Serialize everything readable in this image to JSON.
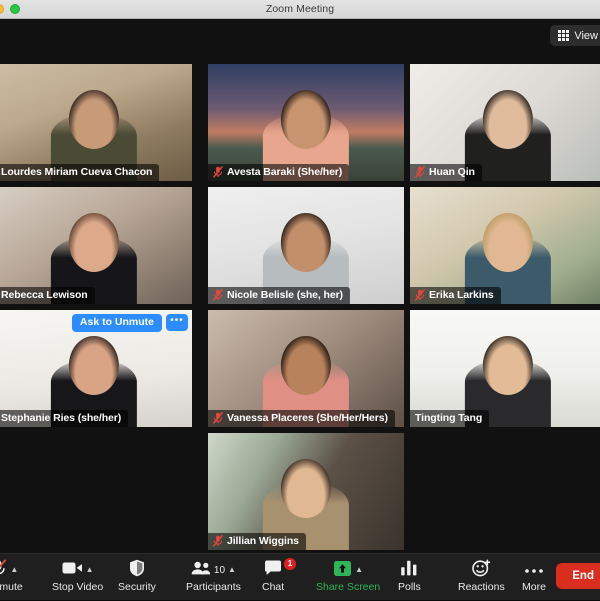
{
  "window": {
    "title": "Zoom Meeting",
    "traffic_lights": [
      "minimize-yellow",
      "maximize-green"
    ]
  },
  "stage": {
    "view_button": {
      "label": "View",
      "icon": "grid-icon"
    }
  },
  "gallery": {
    "participants": [
      {
        "name": "Lourdes Miriam Cueva Chacon",
        "muted": false,
        "speaking": false,
        "row": 1,
        "col": 1,
        "backdrop": "bg-books",
        "skin": "#c79a78",
        "hair": "#241a14",
        "shirt": "#4a4a35"
      },
      {
        "name": "Avesta Baraki (She/her)",
        "muted": true,
        "speaking": false,
        "row": 1,
        "col": 2,
        "backdrop": "bg-campus",
        "skin": "#c89470",
        "hair": "#18100c",
        "shirt": "#e8a68f"
      },
      {
        "name": "Huan Qin",
        "muted": true,
        "speaking": false,
        "row": 1,
        "col": 3,
        "backdrop": "bg-white",
        "skin": "#e0bb9c",
        "hair": "#15110f",
        "shirt": "#20201f"
      },
      {
        "name": "Rebecca Lewison",
        "muted": false,
        "speaking": false,
        "row": 2,
        "col": 1,
        "backdrop": "bg-office",
        "skin": "#dcaa8a",
        "hair": "#55382a",
        "shirt": "#16161a"
      },
      {
        "name": "Nicole Belisle (she, her)",
        "muted": true,
        "speaking": false,
        "row": 2,
        "col": 2,
        "backdrop": "bg-plain",
        "skin": "#c28f6b",
        "hair": "#1b1210",
        "shirt": "#b7bcbe"
      },
      {
        "name": "Erika Larkins",
        "muted": true,
        "speaking": false,
        "row": 2,
        "col": 3,
        "backdrop": "bg-plant",
        "skin": "#e2b894",
        "hair": "#b8995f",
        "shirt": "#3d5a6b"
      },
      {
        "name": "Stephanie Ries (she/her)",
        "muted": false,
        "speaking": false,
        "row": 3,
        "col": 1,
        "backdrop": "bg-pale",
        "skin": "#d9a385",
        "hair": "#1d1512",
        "shirt": "#17171a",
        "controls": {
          "ask_to_unmute": "Ask to Unmute",
          "more": "•••"
        }
      },
      {
        "name": "Vanessa Placeres (She/Her/Hers)",
        "muted": true,
        "speaking": false,
        "row": 3,
        "col": 2,
        "backdrop": "bg-interior",
        "skin": "#b8825c",
        "hair": "#140e0a",
        "shirt": "#e08f85"
      },
      {
        "name": "Tingting Tang",
        "muted": false,
        "speaking": true,
        "row": 3,
        "col": 3,
        "backdrop": "bg-bright",
        "skin": "#e3bb97",
        "hair": "#17120f",
        "shirt": "#2a2a2c"
      },
      {
        "name": "Jillian Wiggins",
        "muted": true,
        "speaking": false,
        "row": 4,
        "col": 2,
        "backdrop": "bg-window",
        "skin": "#e0b893",
        "hair": "#241a13",
        "shirt": "#a8916f"
      }
    ]
  },
  "toolbar": {
    "items": [
      {
        "label": "Unmute",
        "icon": "mic-muted-icon",
        "caret": true,
        "green": false
      },
      {
        "label": "Stop Video",
        "icon": "video-icon",
        "caret": true,
        "green": false
      },
      {
        "label": "Security",
        "icon": "shield-icon",
        "caret": false,
        "green": false
      },
      {
        "label": "Participants",
        "icon": "participants-icon",
        "caret": true,
        "green": false,
        "count": "10"
      },
      {
        "label": "Chat",
        "icon": "chat-icon",
        "caret": false,
        "green": false,
        "badge": "1"
      },
      {
        "label": "Share Screen",
        "icon": "share-screen-icon",
        "caret": true,
        "green": true
      },
      {
        "label": "Polls",
        "icon": "polls-icon",
        "caret": false,
        "green": false
      },
      {
        "label": "Reactions",
        "icon": "reactions-icon",
        "caret": false,
        "green": false
      },
      {
        "label": "More",
        "icon": "more-icon",
        "caret": false,
        "green": false
      }
    ],
    "end_button": {
      "label": "End"
    }
  },
  "colors": {
    "accent_blue": "#2d8cff",
    "end_red": "#d92d20",
    "share_green": "#2fb457",
    "speaking_border": "#b6e318",
    "badge_red": "#e02020",
    "toolbar_bg": "#1f1f1f",
    "stage_bg": "#111112"
  }
}
